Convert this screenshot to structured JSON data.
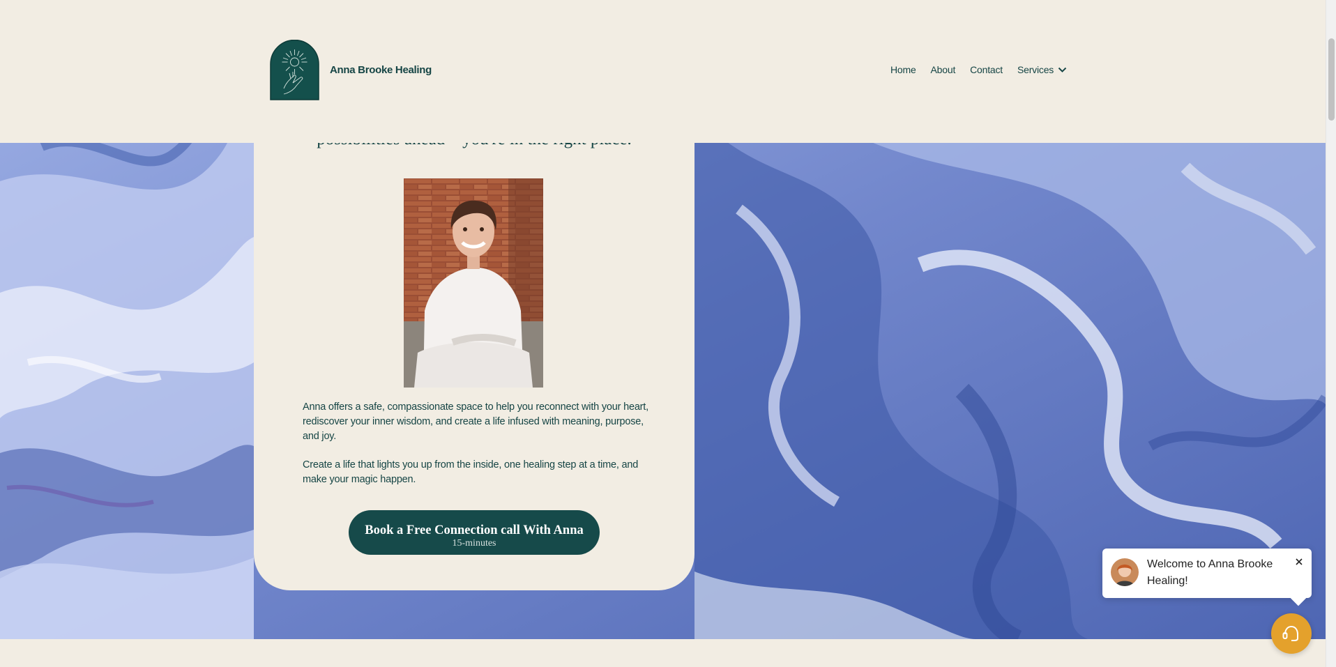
{
  "brand": {
    "name": "Anna Brooke Healing",
    "logo_icon": "sunburst-hand-arch-logo",
    "color": "#164545"
  },
  "nav": {
    "items": [
      "Home",
      "About",
      "Contact"
    ],
    "services_label": "Services"
  },
  "hero": {
    "cut_line": "possibilities ahead – you're in the right place.",
    "paragraph_1": "Anna offers a safe, compassionate space to help you reconnect with your heart, rediscover your inner wisdom, and create a life infused with meaning, purpose, and joy.",
    "paragraph_2": "Create a life that lights you up from the inside, one healing step at a time, and make your magic happen.",
    "cta_label": "Book a Free Connection call With Anna",
    "cta_sublabel": "15-minutes"
  },
  "chat": {
    "message": "Welcome to Anna Brooke Healing!",
    "launcher_icon": "chat-support-icon",
    "launcher_color": "#e4a12c"
  },
  "colors": {
    "background": "#f2ede3",
    "primary": "#164a4a",
    "marble_blue": "#7e93d4"
  }
}
